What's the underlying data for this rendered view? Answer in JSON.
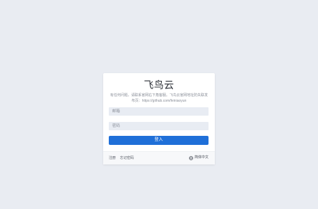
{
  "login": {
    "title": "飞鸟云",
    "notice": "有任何问题，请联系官网右下角客服。飞鸟云官网地址防失联发布页：https://github.com/feiniaoyun",
    "email_placeholder": "邮箱",
    "password_placeholder": "密码",
    "submit_label": "登入"
  },
  "footer": {
    "register_label": "注册",
    "forgot_label": "忘记密码",
    "language_label": "简体中文",
    "language_icon": "globe-icon"
  },
  "colors": {
    "background": "#e9ecf2",
    "primary": "#1f6fd8",
    "input_bg": "#e8ecf3"
  }
}
